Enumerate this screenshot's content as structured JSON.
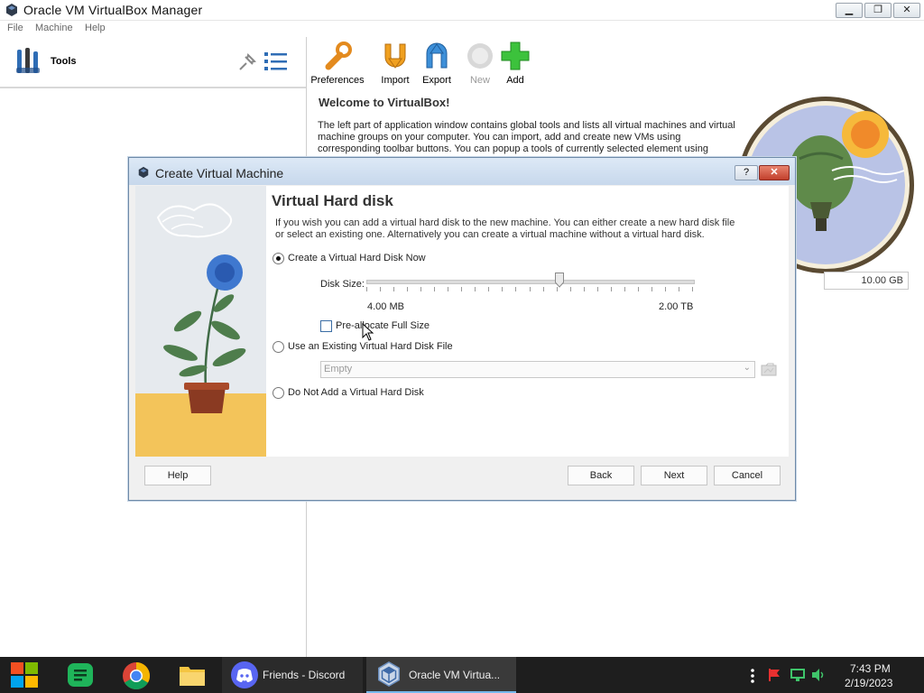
{
  "window": {
    "title": "Oracle VM VirtualBox Manager"
  },
  "menu": [
    "File",
    "Machine",
    "Help"
  ],
  "left_pane": {
    "tools_label": "Tools"
  },
  "toolbar": {
    "preferences": "Preferences",
    "import": "Import",
    "export": "Export",
    "new": "New",
    "add": "Add"
  },
  "welcome": {
    "title": "Welcome to VirtualBox!",
    "text": "The left part of application window contains global tools and lists all virtual machines and virtual machine groups on your computer. You can import, add and create new VMs using corresponding toolbar buttons. You can popup a tools of currently selected element using"
  },
  "dialog": {
    "title": "Create Virtual Machine",
    "help_icon": "?",
    "section_title": "Virtual Hard disk",
    "description": "If you wish you can add a virtual hard disk to the new machine. You can either create a new hard disk file or select an existing one. Alternatively you can create a virtual machine without a virtual hard disk.",
    "options": {
      "create_now": "Create a Virtual Hard Disk Now",
      "use_existing": "Use an Existing Virtual Hard Disk File",
      "do_not_add": "Do Not Add a Virtual Hard Disk"
    },
    "selected_option": "create_now",
    "disk_size_label": "Disk Size:",
    "disk_size_value": "10.00 GB",
    "slider_min_label": "4.00 MB",
    "slider_max_label": "2.00 TB",
    "slider_fraction": 0.59,
    "preallocate_label": "Pre-allocate Full Size",
    "preallocate_checked": false,
    "existing_file_value": "Empty",
    "buttons": {
      "help": "Help",
      "back": "Back",
      "next": "Next",
      "cancel": "Cancel"
    }
  },
  "taskbar": {
    "discord_label": "Friends - Discord",
    "vbox_label": "Oracle VM Virtua...",
    "time": "7:43 PM",
    "date": "2/19/2023"
  },
  "colors": {
    "accent": "#3b6ea5",
    "taskbar": "#1e1e1e",
    "dialog_title": "#c7d8ec"
  }
}
